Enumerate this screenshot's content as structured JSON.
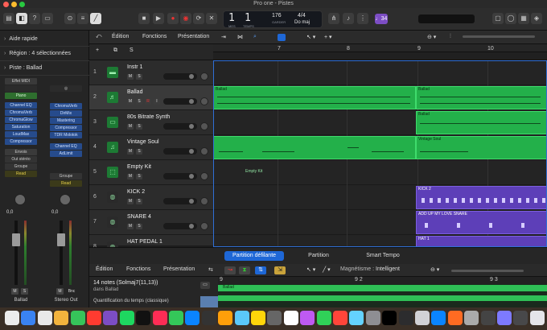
{
  "window": {
    "title": "Pro one - Pistes"
  },
  "transport": {
    "bar": "1",
    "beat": "1",
    "bar_label": "MES",
    "beat_label": "TEMPS",
    "tempo": "176",
    "tempo_label": "GARDER",
    "signature": "4/4",
    "key": "Do maj",
    "count_in": "♩34"
  },
  "inspector": {
    "quick_help": "Aide rapide",
    "region_label": "Région :",
    "region_value": "4 sélectionnées",
    "track_label": "Piste :",
    "track_value": "Ballad",
    "left_strip": {
      "input_label": "Effet MIDI",
      "instrument": "Piano",
      "plugins": [
        "Channel EQ",
        "ChromaVerb",
        "ChromaGlow",
        "Saturation",
        "LoudMax",
        "Compressor"
      ],
      "sends": "Envois",
      "output": "Out stéréo",
      "group": "Groupe",
      "automation": "Read",
      "value": "0,0",
      "mute": "M",
      "solo": "S",
      "name": "Ballad"
    },
    "right_strip": {
      "plugins": [
        "ChromaVerb",
        "DirMix",
        "Mastering",
        "Compressor",
        "TDR Molotok"
      ],
      "plugins2": [
        "Channel EQ",
        "AdLimit"
      ],
      "group": "Groupe",
      "automation": "Read",
      "value": "0,0",
      "mute": "M",
      "bounce": "Bnc",
      "name": "Stereo Out"
    }
  },
  "tracks_header": {
    "edit": "Édition",
    "functions": "Fonctions",
    "view": "Présentation"
  },
  "ruler": {
    "marks": [
      "7",
      "8",
      "9",
      "10"
    ]
  },
  "tracks": [
    {
      "num": "1",
      "name": "Instr 1",
      "selected": false
    },
    {
      "num": "2",
      "name": "Ballad",
      "selected": true
    },
    {
      "num": "3",
      "name": "80s Bitrate Synth",
      "selected": false
    },
    {
      "num": "4",
      "name": "Vintage Soul",
      "selected": false
    },
    {
      "num": "5",
      "name": "Empty Kit",
      "selected": false
    },
    {
      "num": "6",
      "name": "KICK 2",
      "selected": false
    },
    {
      "num": "7",
      "name": "SNARE 4",
      "selected": false
    },
    {
      "num": "8",
      "name": "HAT PEDAL 1",
      "selected": false
    }
  ],
  "track_buttons": {
    "mute": "M",
    "solo": "S",
    "rec": "R",
    "input": "I"
  },
  "regions": {
    "ballad_a": "Ballad",
    "ballad_b": "Ballad",
    "vintage_b": "Vintage Soul",
    "empty_kit": "Empty Kit",
    "kick": "KICK 2",
    "snare": "ADD UP MY LOVE SNARE",
    "hat": "HAT 1"
  },
  "editor": {
    "tabs": [
      "Partition défilante",
      "Partition",
      "Smart Tempo"
    ],
    "active_tab": 0,
    "edit": "Édition",
    "functions": "Fonctions",
    "view": "Présentation",
    "magnetism_label": "Magnétisme :",
    "magnetism_value": "Intelligent",
    "info_line1": "14 notes (Solmaj7(11,13))",
    "info_line2": "dans Ballad",
    "quantize_label": "Quantification du temps (classique)",
    "ruler": [
      "9",
      "9 2",
      "9 3"
    ],
    "region_name": "Ballad"
  },
  "colors": {
    "region_green": "#23b04a",
    "region_purple": "#5d3fb8",
    "accent_blue": "#1e67d6"
  }
}
